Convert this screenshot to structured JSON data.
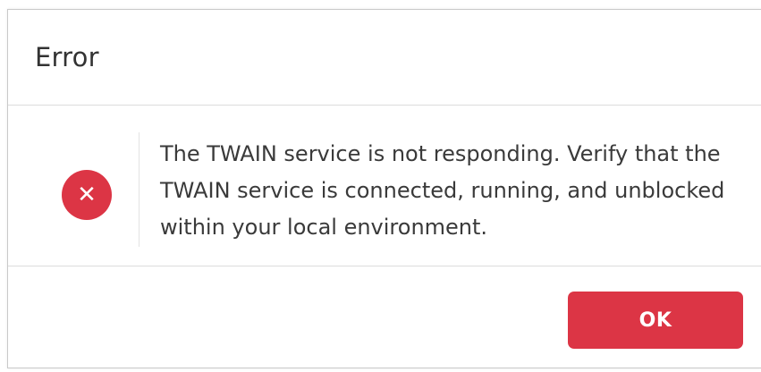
{
  "dialog": {
    "title": "Error",
    "icon": "error-x-circle-icon",
    "icon_glyph": "✕",
    "message": "The TWAIN service is not responding. Verify that the TWAIN service is connected, running, and unblocked within your local environment.",
    "ok_label": "OK"
  },
  "colors": {
    "accent": "#dc3545",
    "text": "#333333",
    "divider": "#dcdcdc"
  }
}
